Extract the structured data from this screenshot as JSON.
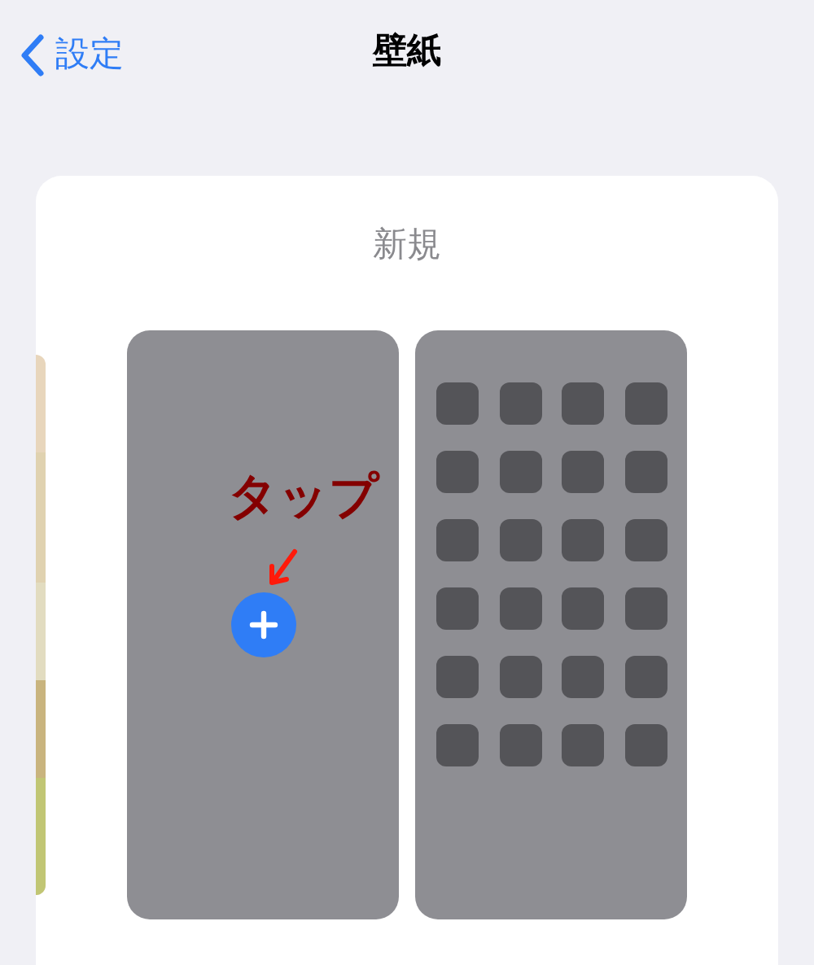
{
  "nav_bar": {
    "back_label": "設定",
    "title": "壁紙"
  },
  "wallpaper_card": {
    "title": "新規",
    "annotation": "タップ"
  }
}
